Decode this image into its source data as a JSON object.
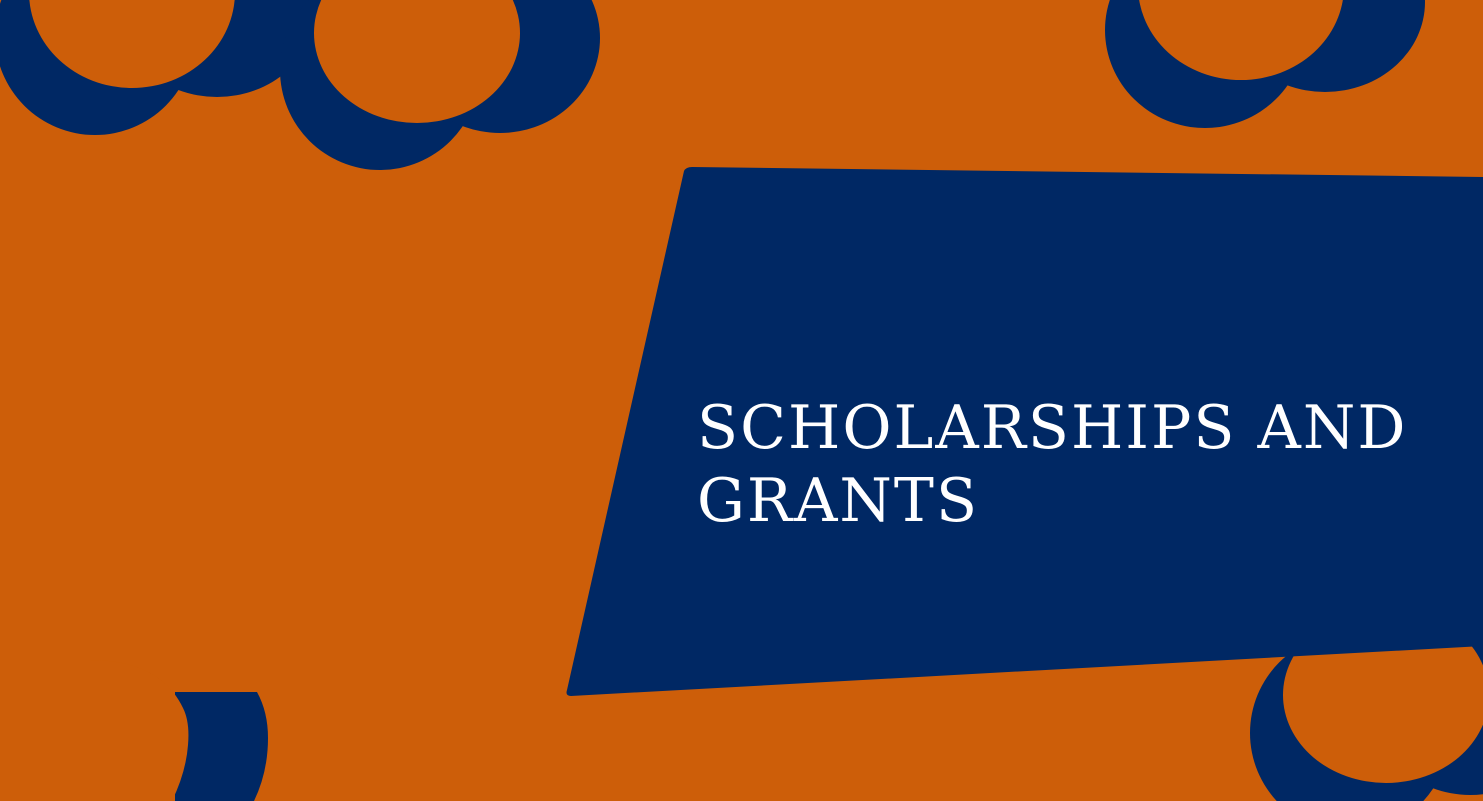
{
  "slide": {
    "title": "SCHOLARSHIPS AND GRANTS"
  },
  "colors": {
    "background": "#cd5e09",
    "accent": "#002864",
    "title_text": "#ffffff"
  }
}
